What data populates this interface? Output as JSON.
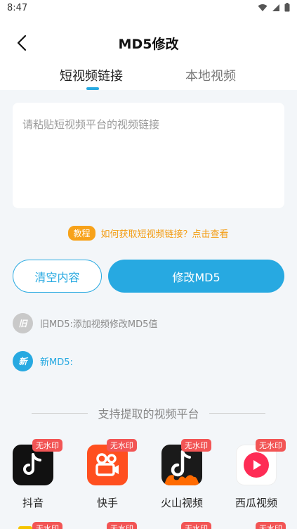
{
  "status_bar": {
    "time": "8:47"
  },
  "nav": {
    "title": "MD5修改",
    "back_icon": "chevron-left-icon"
  },
  "tabs": [
    {
      "label": "短视频链接",
      "active": true
    },
    {
      "label": "本地视频",
      "active": false
    }
  ],
  "link_input": {
    "placeholder": "请粘贴短视频平台的视频链接",
    "value": ""
  },
  "tutorial": {
    "badge": "教程",
    "link_text": "如何获取短视频链接？点击查看"
  },
  "buttons": {
    "clear": "清空内容",
    "modify": "修改MD5"
  },
  "md5": {
    "old_badge": "旧",
    "old_text": "旧MD5:添加视频修改MD5值",
    "new_badge": "新",
    "new_text": "新MD5:"
  },
  "platforms_section": {
    "title": "支持提取的视频平台",
    "items": [
      {
        "name": "抖音",
        "badge": "无水印",
        "icon": "douyin-icon"
      },
      {
        "name": "快手",
        "badge": "无水印",
        "icon": "kuaishou-icon"
      },
      {
        "name": "火山视频",
        "badge": "无水印",
        "icon": "huoshan-icon"
      },
      {
        "name": "西瓜视频",
        "badge": "无水印",
        "icon": "xigua-icon"
      }
    ],
    "next_row_badges": [
      "无水印",
      "无水印",
      "无水印",
      "无水印"
    ]
  },
  "colors": {
    "accent": "#27a9e1",
    "orange": "#f39c12",
    "badge_red": "#f25555"
  }
}
